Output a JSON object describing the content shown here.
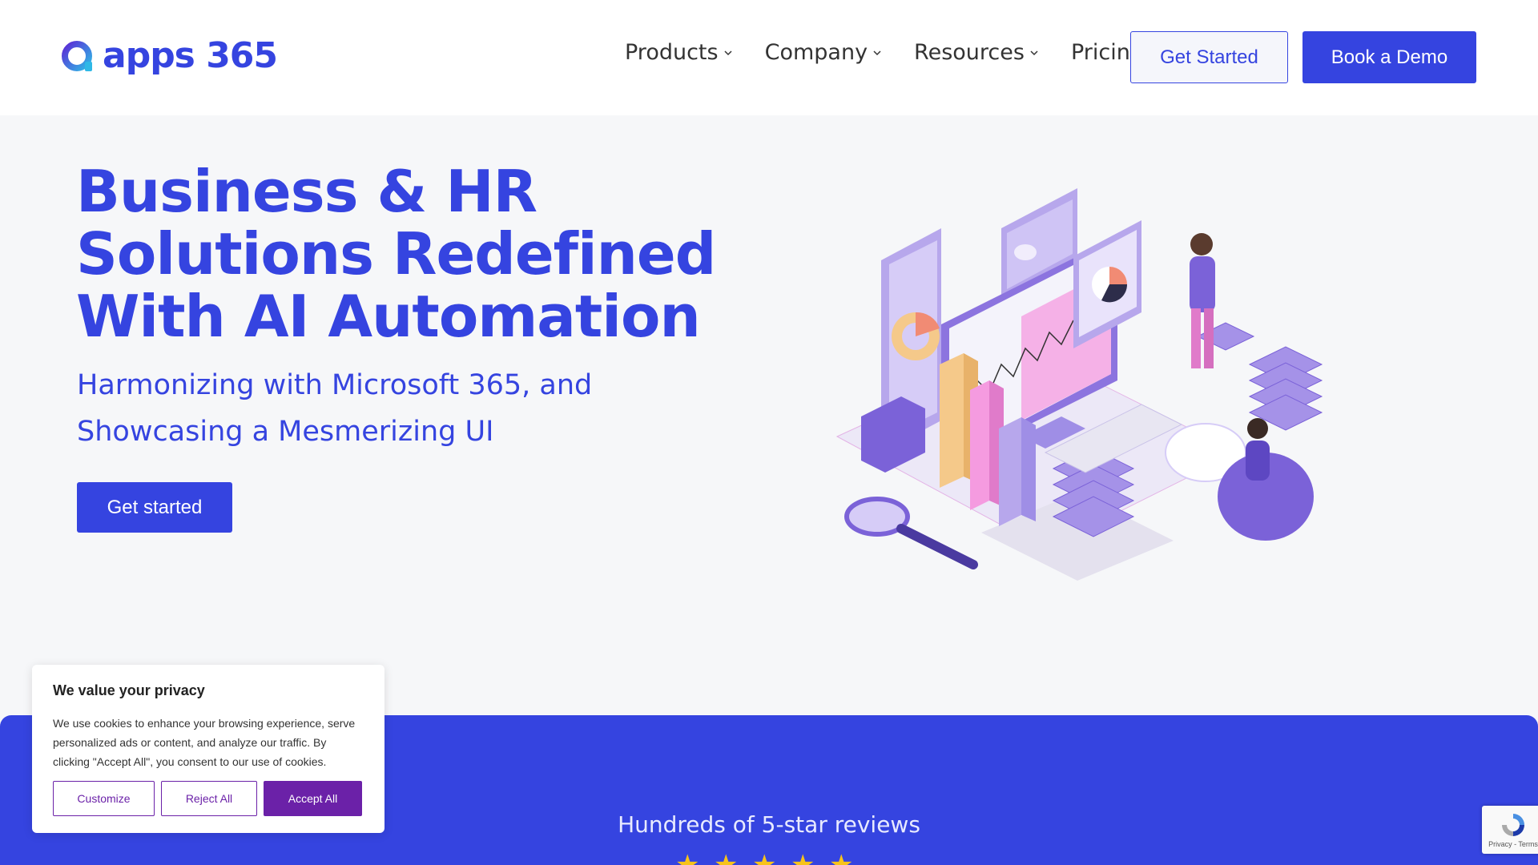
{
  "brand": {
    "name": "apps 365",
    "color": "#3544e0"
  },
  "nav": {
    "items": [
      {
        "label": "Products",
        "has_dropdown": true
      },
      {
        "label": "Company",
        "has_dropdown": true
      },
      {
        "label": "Resources",
        "has_dropdown": true
      },
      {
        "label": "Pricing",
        "has_dropdown": false
      }
    ],
    "get_started": "Get Started",
    "book_demo": "Book a Demo"
  },
  "hero": {
    "title_line1": "Business & HR",
    "title_line2": "Solutions Redefined",
    "title_line3": "With AI Automation",
    "subtitle": "Harmonizing with Microsoft 365, and Showcasing a Mesmerizing UI",
    "cta": "Get started"
  },
  "band": {
    "reviews_text": "Hundreds of 5-star reviews",
    "stars": 5,
    "star_color": "#f7c31a"
  },
  "cookie": {
    "title": "We value your privacy",
    "body": "We use cookies to enhance your browsing experience, serve personalized ads or content, and analyze our traffic. By clicking \"Accept All\", you consent to our use of cookies.",
    "customize": "Customize",
    "reject": "Reject All",
    "accept": "Accept All",
    "accent": "#6b21a8"
  },
  "recaptcha": {
    "label": "Privacy - Terms"
  }
}
